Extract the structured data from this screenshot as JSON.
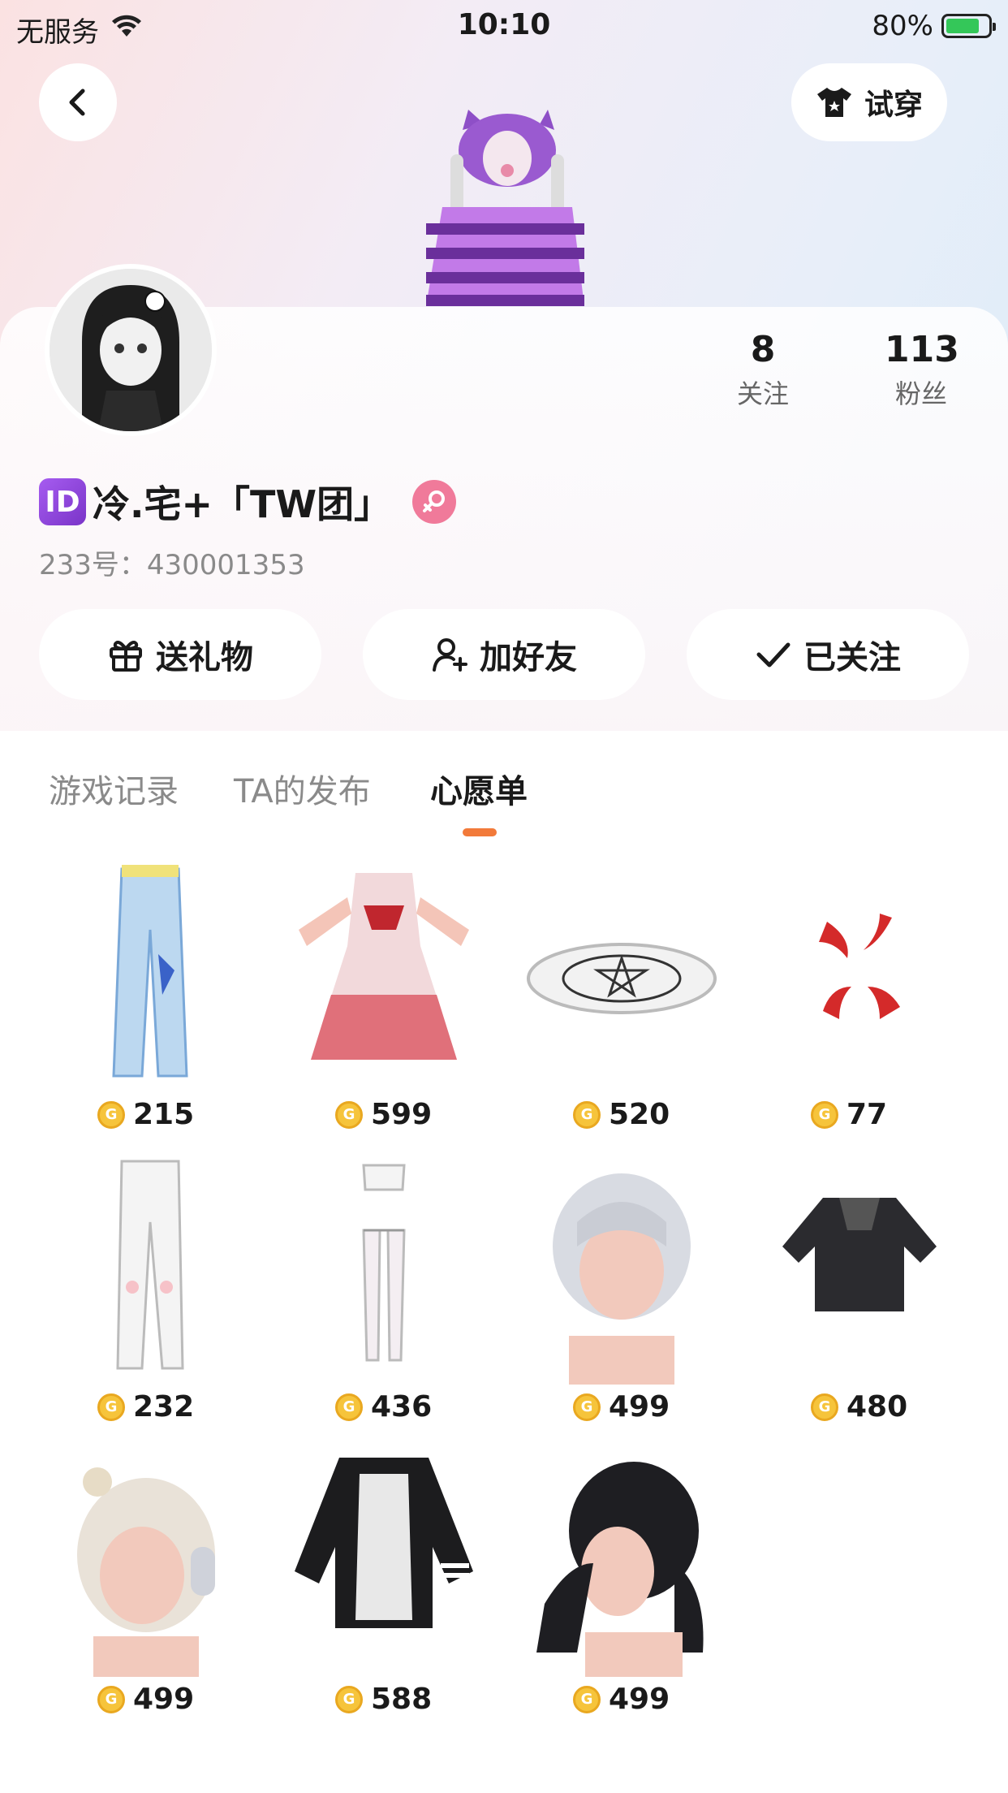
{
  "status_bar": {
    "carrier": "无服务",
    "time": "10:10",
    "battery": "80%"
  },
  "header": {
    "tryon_label": "试穿"
  },
  "profile": {
    "id_badge": "ID",
    "name": "冷.宅+「TW团」",
    "user_id": "233号：430001353",
    "following_count": "8",
    "following_label": "关注",
    "followers_count": "113",
    "followers_label": "粉丝"
  },
  "actions": {
    "gift_label": "送礼物",
    "add_friend_label": "加好友",
    "followed_label": "已关注"
  },
  "tabs": [
    {
      "label": "游戏记录"
    },
    {
      "label": "TA的发布"
    },
    {
      "label": "心愿单"
    }
  ],
  "wishlist": [
    {
      "item": "light-blue-pants",
      "price": "215"
    },
    {
      "item": "red-maid-dress",
      "price": "599"
    },
    {
      "item": "pentagram-halo",
      "price": "520"
    },
    {
      "item": "anger-mark",
      "price": "77"
    },
    {
      "item": "white-leggings",
      "price": "232"
    },
    {
      "item": "white-stockings",
      "price": "436"
    },
    {
      "item": "silver-hair",
      "price": "499"
    },
    {
      "item": "black-hoodie",
      "price": "480"
    },
    {
      "item": "headphone-hair",
      "price": "499"
    },
    {
      "item": "printed-sweater",
      "price": "588"
    },
    {
      "item": "black-twintail-hair",
      "price": "499"
    }
  ],
  "colors": {
    "accent": "#f27a3a",
    "coin": "#f6c43b",
    "id_badge": "#8a43d8",
    "gender_badge": "#f07a9a"
  }
}
